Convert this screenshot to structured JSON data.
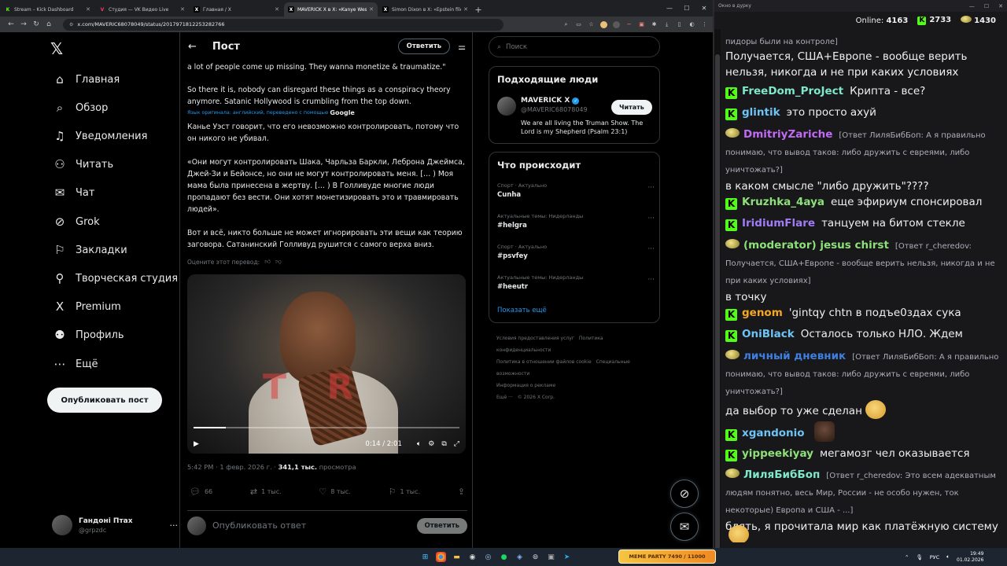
{
  "browser": {
    "tabs": [
      {
        "title": "Stream – Kick Dashboard",
        "icon": "K",
        "color": "#53fc18"
      },
      {
        "title": "Студия — VK Видео Live",
        "icon": "V",
        "color": "#ff3366"
      },
      {
        "title": "Главная / X",
        "icon": "X",
        "color": "#ffffff"
      },
      {
        "title": "MAVERICK X в X: «Kanye West…",
        "icon": "X",
        "color": "#ffffff"
      },
      {
        "title": "Simon Dixon в X: «Epstein files…",
        "icon": "X",
        "color": "#ffffff"
      }
    ],
    "active_tab": 3,
    "url": "x.com/MAVERIC68078049/status/2017971812253282766"
  },
  "x": {
    "nav": [
      {
        "label": "Главная",
        "icon": "home-icon",
        "glyph": "⌂"
      },
      {
        "label": "Обзор",
        "icon": "search-icon",
        "glyph": "⌕"
      },
      {
        "label": "Уведомления",
        "icon": "bell-icon",
        "glyph": "♫"
      },
      {
        "label": "Читать",
        "icon": "follow-icon",
        "glyph": "⚇"
      },
      {
        "label": "Чат",
        "icon": "mail-icon",
        "glyph": "✉"
      },
      {
        "label": "Grok",
        "icon": "grok-icon",
        "glyph": "⊘"
      },
      {
        "label": "Закладки",
        "icon": "bookmark-icon",
        "glyph": "⚐"
      },
      {
        "label": "Творческая студия",
        "icon": "studio-icon",
        "glyph": "⚲"
      },
      {
        "label": "Premium",
        "icon": "x-premium-icon",
        "glyph": "X"
      },
      {
        "label": "Профиль",
        "icon": "profile-icon",
        "glyph": "⚉"
      },
      {
        "label": "Ещё",
        "icon": "more-icon",
        "glyph": "⋯"
      }
    ],
    "post_button": "Опубликовать пост",
    "account": {
      "name": "Гандоні Птах",
      "handle": "@grpzdc"
    },
    "header": {
      "title": "Пост",
      "reply_button": "Ответить"
    },
    "post": {
      "text_en_1": "a lot of people come up missing. They wanna monetize & traumatize.\"",
      "text_en_2": "So there it is, nobody can disregard these things as a conspiracy theory anymore. Satanic Hollywood is crumbling from the top down.",
      "translate_note": "Язык оригинала: английский, переведено с помощью",
      "translate_brand": "Google",
      "text_ru_1": "Канье Уэст говорит, что его невозможно контролировать, потому что он никого не убивал.",
      "text_ru_2": "«Они могут контролировать Шака, Чарльза Баркли, Леброна Джеймса, Джей-Зи и Бейонсе, но они не могут контролировать меня. [… ) Моя мама была принесена в жертву. [… ) В Голливуде многие люди пропадают без вести. Они хотят монетизировать это и травмировать людей».",
      "text_ru_3": "Вот и всё, никто больше не может игнорировать эти вещи как теорию заговора. Сатанинский Голливуд рушится с самого верха вниз.",
      "rate_translation": "Оцените этот перевод:",
      "video": {
        "time": "0:14 / 2:01",
        "progress": 0.12,
        "watermark": "T R"
      },
      "time": "5:42 PM · 1 февр. 2026 г.",
      "views": "341,1 тыс.",
      "views_label": "просмотра",
      "stats": {
        "replies": "66",
        "reposts": "1 тыс.",
        "likes": "8 тыс.",
        "bookmarks": "1 тыс."
      }
    },
    "reply_placeholder": "Опубликовать ответ",
    "reply_button": "Ответить",
    "search_placeholder": "Поиск",
    "who_to_follow": {
      "title": "Подходящие люди",
      "name": "MAVERICK X",
      "handle": "@MAVERIC68078049",
      "bio": "We are all living the Truman Show. The Lord is my Shepherd (Psalm 23:1)",
      "follow": "Читать"
    },
    "trends": {
      "title": "Что происходит",
      "items": [
        {
          "category": "Спорт · Актуально",
          "name": "Cunha"
        },
        {
          "category": "Актуальные темы: Нидерланды",
          "name": "#helgra"
        },
        {
          "category": "Спорт · Актуально",
          "name": "#psvfey"
        },
        {
          "category": "Актуальные темы: Нидерланды",
          "name": "#heeutr"
        }
      ],
      "show_more": "Показать ещё"
    },
    "footer": [
      "Условия предоставления услуг",
      "Политика конфиденциальности",
      "Политика в отношении файлов cookie",
      "Специальные возможности",
      "Информация о рекламе",
      "Ещё ···",
      "© 2026 X Corp."
    ]
  },
  "chat": {
    "window_title": "Окно в дурку",
    "online_label": "Online:",
    "online": "4163",
    "kick_count": "2733",
    "vk_count": "1430",
    "messages": [
      {
        "badge": "",
        "user": "",
        "color": "#efeff1",
        "reply": "пидоры были на контроле]",
        "text": ""
      },
      {
        "badge": "",
        "user": "",
        "color": "#efeff1",
        "reply": "",
        "text": "Получается, США+Европе - вообще верить нельзя, никогда и не при каких условиях"
      },
      {
        "badge": "K",
        "user": "FreeDom_ProJect",
        "color": "#7ee8c8",
        "reply": "",
        "text": "Крипта - все?"
      },
      {
        "badge": "K",
        "user": "glintik",
        "color": "#6ec3f5",
        "reply": "",
        "text": "это просто ахуй"
      },
      {
        "badge": "V",
        "user": "DmitriyZariche",
        "color": "#c16bf5",
        "reply": "[Ответ ЛиляБибБоп: А я правильно понимаю, что вывод таков: либо дружить с евреями, либо уничтожать?]",
        "text": "в каком смысле \"либо дружить\"????"
      },
      {
        "badge": "K",
        "user": "Kruzhka_4aya",
        "color": "#8ee07a",
        "reply": "",
        "text": "еще эфириум спонсировал"
      },
      {
        "badge": "K",
        "user": "IridiumFlare",
        "color": "#a07cf5",
        "reply": "",
        "text": "танцуем на битом стекле"
      },
      {
        "badge": "V",
        "user": "(moderator) jesus chirst",
        "color": "#8ee07a",
        "reply": "[Ответ r_cheredov: Получается, США+Европе - вообще верить нельзя, никогда и не при каких условиях]",
        "text": "в точку"
      },
      {
        "badge": "K",
        "user": "genom",
        "color": "#f5a623",
        "reply": "",
        "text": "'gintqy chtn в подъе0здах сука"
      },
      {
        "badge": "K",
        "user": "OniBlack",
        "color": "#6ec3f5",
        "reply": "",
        "text": "Осталось только НЛО. Ждем"
      },
      {
        "badge": "V",
        "user": "личный дневник",
        "color": "#3f7fe0",
        "reply": "[Ответ ЛиляБибБоп: А я правильно понимаю, что вывод таков: либо дружить с евреями, либо уничтожать?]",
        "text": "да выбор то уже сделан"
      },
      {
        "badge": "K",
        "user": "xgandonio",
        "color": "#6ec3f5",
        "reply": "",
        "text": ""
      },
      {
        "badge": "K",
        "user": "yippeekiyay",
        "color": "#8ee07a",
        "reply": "",
        "text": "мегамозг чел оказывается"
      },
      {
        "badge": "V",
        "user": "ЛиляБибБоп",
        "color": "#7ee8c8",
        "reply": "[Ответ r_cheredov: Это всем адекватным людям понятно, весь Мир, России - не особо нужен, ток некоторые) Европа и США - ...]",
        "text": "блять, я прочитала мир как платёжную систему"
      }
    ]
  },
  "taskbar": {
    "meme_bar": "MEME PARTY  7490 / 11000",
    "lang": "РУС",
    "time": "19:49",
    "date": "01.02.2026"
  }
}
